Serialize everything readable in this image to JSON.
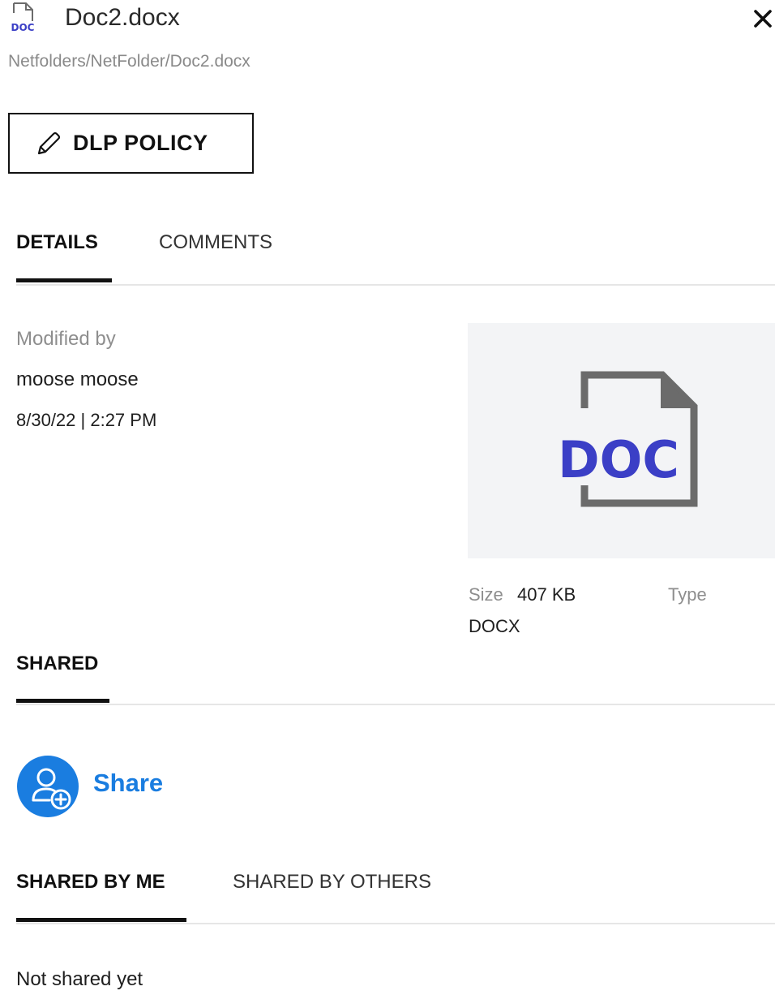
{
  "header": {
    "file_icon": "doc-file-icon",
    "file_icon_text": "DOC",
    "title": "Doc2.docx",
    "close_icon": "close-icon",
    "breadcrumb": "Netfolders/NetFolder/Doc2.docx"
  },
  "actions": {
    "dlp_icon": "pencil-icon",
    "dlp_label": "DLP POLICY"
  },
  "tabs": [
    {
      "label": "DETAILS",
      "active": true
    },
    {
      "label": "COMMENTS",
      "active": false
    }
  ],
  "details": {
    "modified_label": "Modified by",
    "modified_by": "moose moose",
    "modified_at": "8/30/22 | 2:27 PM",
    "preview_icon": "doc-file-preview-icon",
    "preview_text": "DOC",
    "size_label": "Size",
    "size_value": "407 KB",
    "type_label": "Type",
    "type_value": "DOCX"
  },
  "shared": {
    "heading": "SHARED",
    "share_icon": "add-user-icon",
    "share_label": "Share",
    "tabs": [
      {
        "label": "SHARED BY ME",
        "active": true
      },
      {
        "label": "SHARED BY OTHERS",
        "active": false
      }
    ],
    "empty_text": "Not shared yet"
  },
  "colors": {
    "accent_blue": "#1a7de0",
    "doc_purple": "#3b3fc6",
    "icon_gray": "#6b6b6b",
    "preview_bg": "#f3f4f6"
  }
}
